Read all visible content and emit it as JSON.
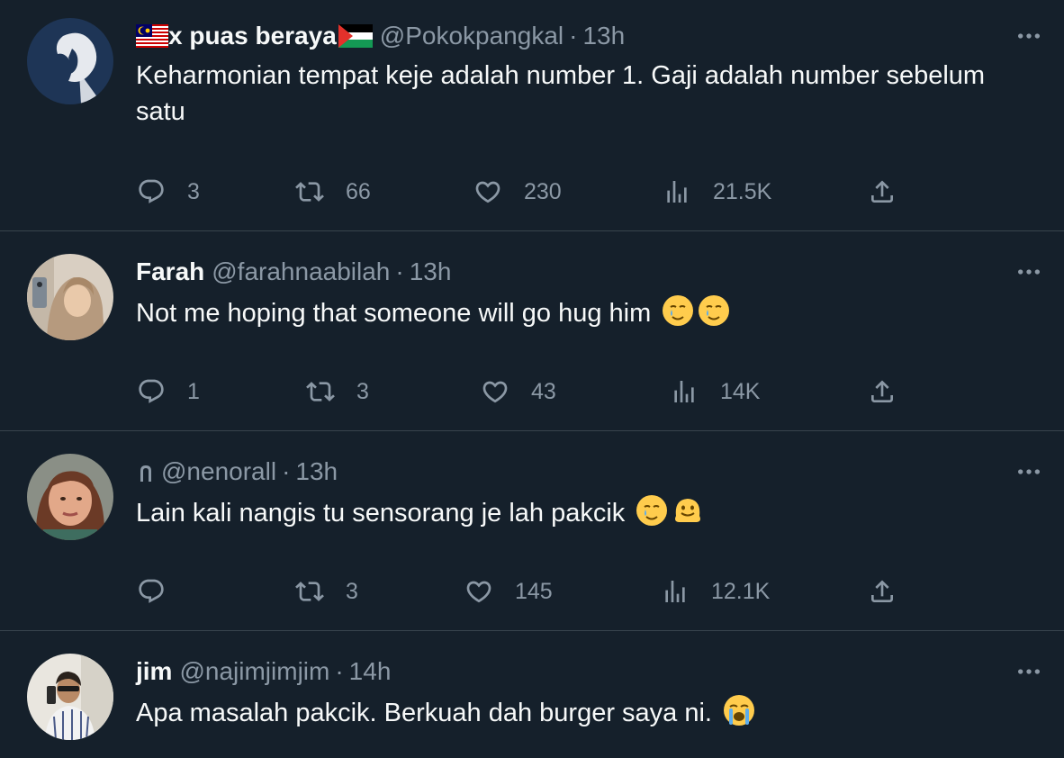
{
  "tweets": [
    {
      "name": "x puas beraya",
      "handle": "@Pokokpangkal",
      "time": "13h",
      "text": "Keharmonian tempat keje adalah number 1. Gaji adalah number sebelum satu",
      "replies": "3",
      "retweets": "66",
      "likes": "230",
      "views": "21.5K",
      "flags": [
        "malaysia-flag-icon",
        "palestine-flag-icon"
      ]
    },
    {
      "name": "Farah",
      "handle": "@farahnaabilah",
      "time": "13h",
      "text": "Not me hoping that someone will go hug him",
      "emojis": [
        "face-holding-back-tears-icon",
        "face-holding-back-tears-icon"
      ],
      "replies": "1",
      "retweets": "3",
      "likes": "43",
      "views": "14K"
    },
    {
      "name": "",
      "handle": "@nenorall",
      "time": "13h",
      "text": "Lain kali nangis tu sensorang je lah pakcik",
      "emojis": [
        "face-holding-back-tears-icon",
        "melting-face-icon"
      ],
      "replies": "",
      "retweets": "3",
      "likes": "145",
      "views": "12.1K",
      "name_icon": "arch-icon"
    },
    {
      "name": "jim",
      "handle": "@najimjimjim",
      "time": "14h",
      "text": "Apa masalah pakcik. Berkuah dah burger saya ni.",
      "emojis": [
        "loudly-crying-face-icon"
      ]
    }
  ],
  "separator": "·",
  "colors": {
    "background": "#15202b",
    "divider": "#38444d",
    "text_primary": "#f7f9f9",
    "text_secondary": "#8b98a5"
  }
}
